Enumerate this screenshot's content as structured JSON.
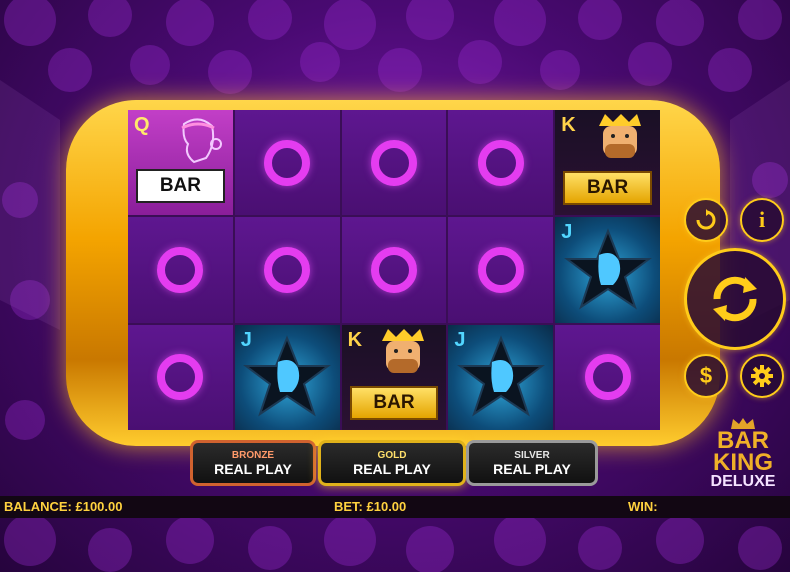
{
  "game_title": {
    "line1": "BAR",
    "line2": "KING",
    "line3": "DELUXE"
  },
  "reels": [
    [
      {
        "type": "queen",
        "letter": "Q",
        "bar": "BAR"
      },
      {
        "type": "ring"
      },
      {
        "type": "ring"
      }
    ],
    [
      {
        "type": "ring"
      },
      {
        "type": "ring"
      },
      {
        "type": "jack",
        "letter": "J"
      }
    ],
    [
      {
        "type": "ring"
      },
      {
        "type": "ring"
      },
      {
        "type": "king",
        "letter": "K",
        "bar": "BAR"
      }
    ],
    [
      {
        "type": "ring"
      },
      {
        "type": "ring"
      },
      {
        "type": "jack",
        "letter": "J"
      }
    ],
    [
      {
        "type": "king",
        "letter": "K",
        "bar": "BAR"
      },
      {
        "type": "jack",
        "letter": "J"
      },
      {
        "type": "ring"
      }
    ]
  ],
  "bet_buttons": [
    {
      "tier": "BRONZE",
      "label": "REAL PLAY",
      "tier_color": "#ff9a6a",
      "border": "#d0622f"
    },
    {
      "tier": "GOLD",
      "label": "REAL PLAY",
      "tier_color": "#ffe06b",
      "border": "#e0b21a"
    },
    {
      "tier": "SILVER",
      "label": "REAL PLAY",
      "tier_color": "#e6e6e6",
      "border": "#9a9a9a"
    }
  ],
  "status_bar": {
    "balance_label": "BALANCE: £100.00",
    "bet_label": "BET: £10.00",
    "win_label": "WIN:"
  },
  "side_buttons": {
    "autoplay_icon": "autoplay-icon",
    "info_label": "i",
    "spin_icon": "spin-arrows-icon",
    "stake_label": "$",
    "settings_icon": "gear-icon"
  },
  "colors": {
    "accent": "#ffcc1a",
    "ring": "#e43cf0",
    "text_gold": "#ffd23f"
  }
}
